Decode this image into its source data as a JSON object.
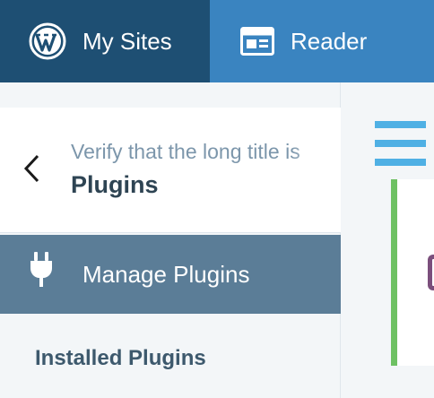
{
  "masterbar": {
    "my_sites_label": "My Sites",
    "reader_label": "Reader",
    "my_sites_icon": "wordpress-logo-icon",
    "reader_icon": "reader-icon"
  },
  "header": {
    "subtitle": "Verify that the long title is",
    "title": "Plugins",
    "back_icon": "chevron-left-icon"
  },
  "sidebar": {
    "manage_label": "Manage Plugins",
    "manage_icon": "plug-icon",
    "installed_label": "Installed Plugins"
  },
  "content": {
    "menu_icon": "hamburger-menu-icon"
  },
  "colors": {
    "my_sites_bg": "#1e4f73",
    "reader_bg": "#3a84c0",
    "manage_bg": "#5b7d97",
    "accent": "#4fb0e4",
    "active_border": "#6ec163"
  }
}
